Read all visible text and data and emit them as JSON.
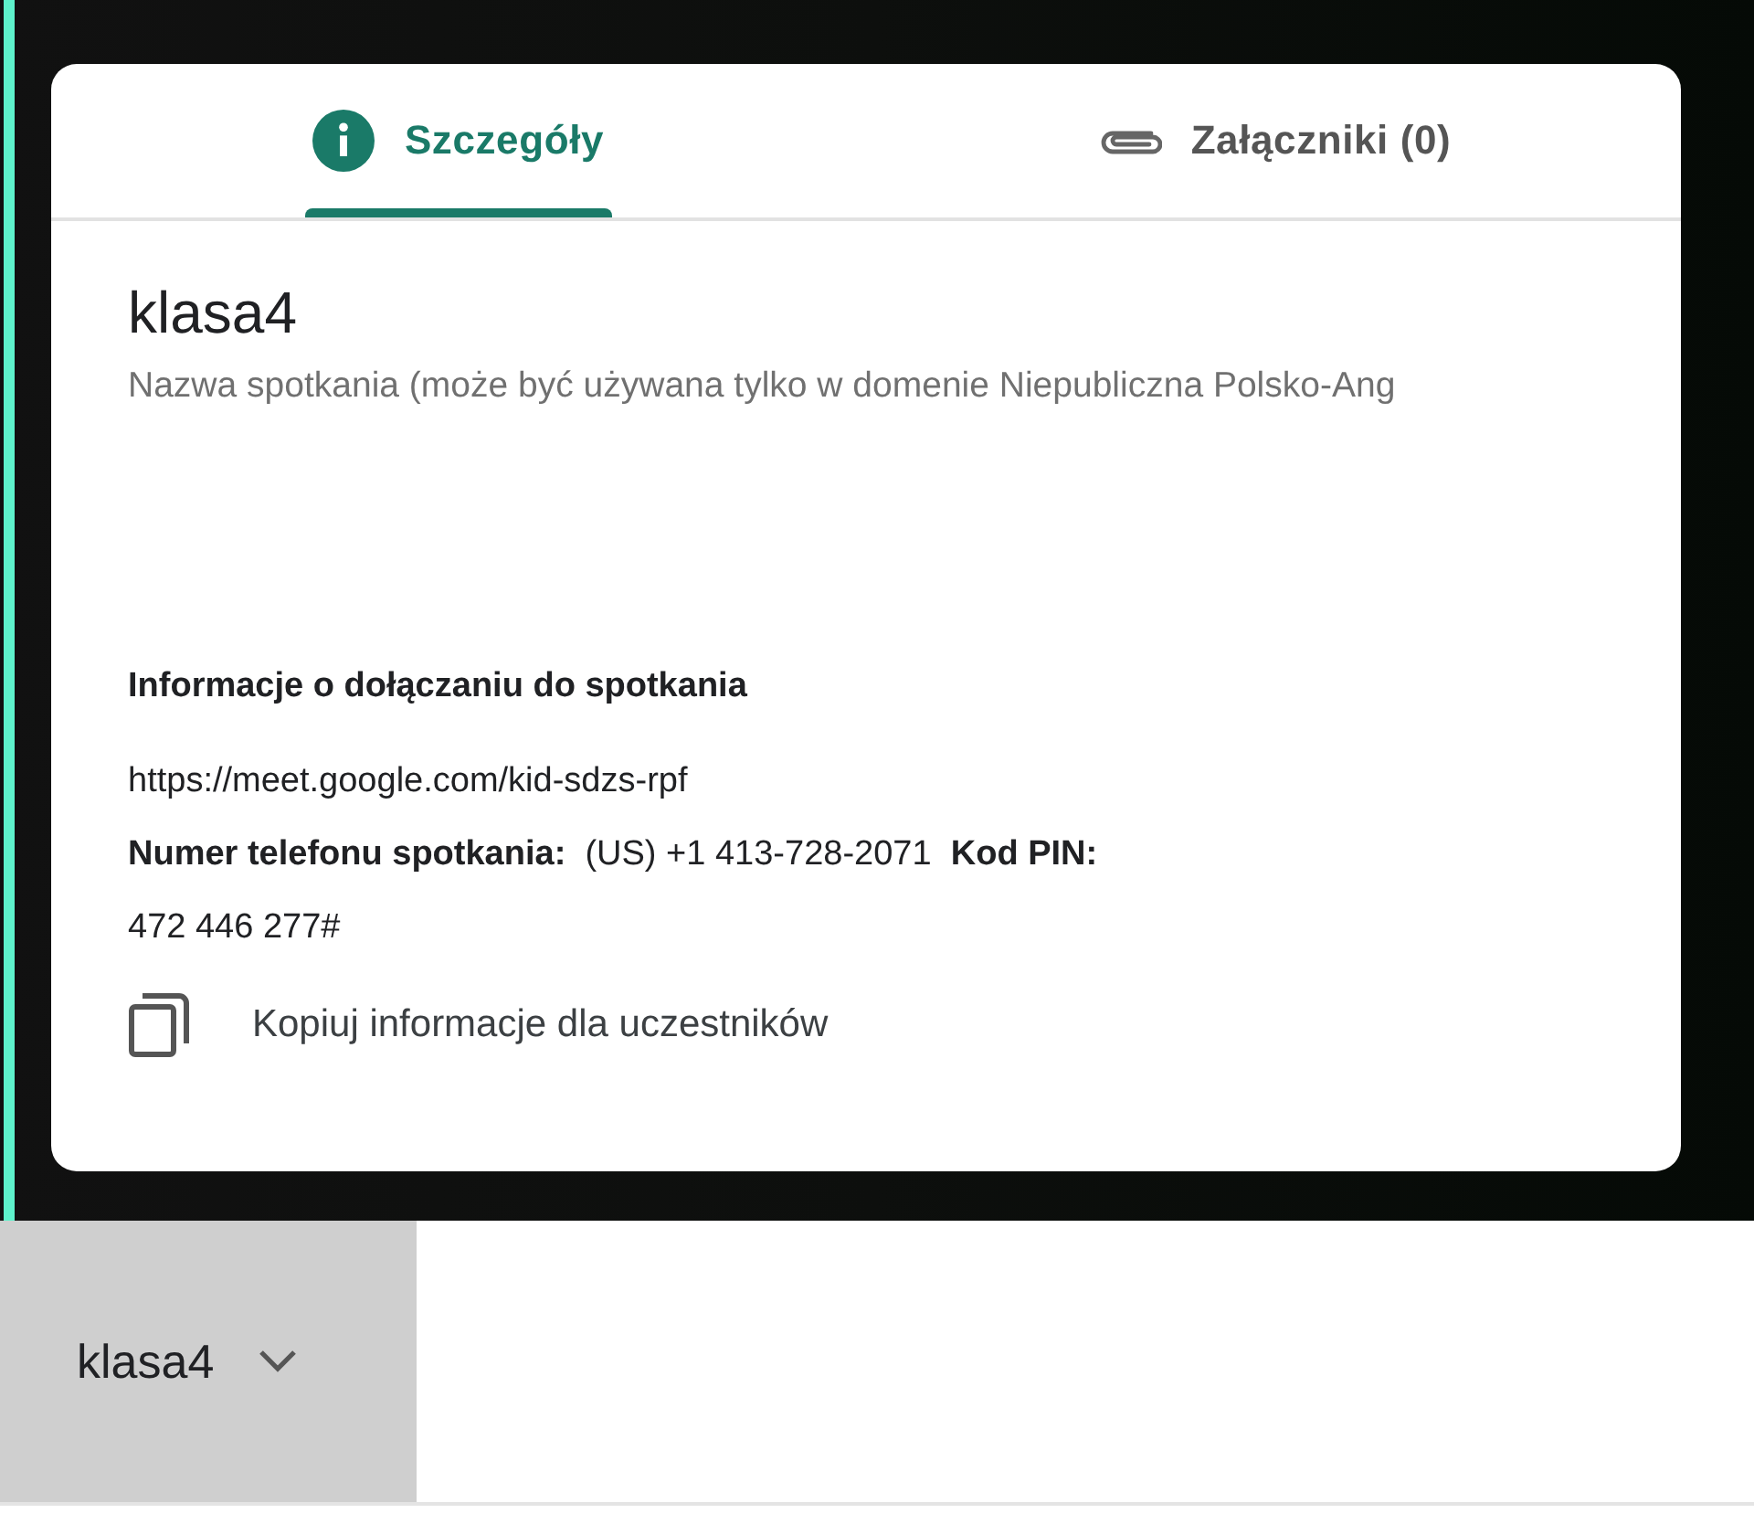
{
  "tabs": [
    {
      "label": "Szczegóły",
      "kind": "info",
      "selected": true
    },
    {
      "label": "Załączniki (0)",
      "kind": "attachment",
      "selected": false
    }
  ],
  "meeting": {
    "title": "klasa4",
    "subtitle": "Nazwa spotkania (może być używana tylko w domenie Niepubliczna Polsko-Ang"
  },
  "join_info": {
    "heading": "Informacje o dołączaniu do spotkania",
    "link": "https://meet.google.com/kid-sdzs-rpf",
    "phone_line": "**Numer telefonu spotkania:**  (US) +1 413-728-2071  **Kod PIN:**",
    "pin": "472 446 277#",
    "copy_action": "Kopiuj informacje dla uczestników"
  },
  "bottom_bar": {
    "meeting_name": "klasa4"
  }
}
